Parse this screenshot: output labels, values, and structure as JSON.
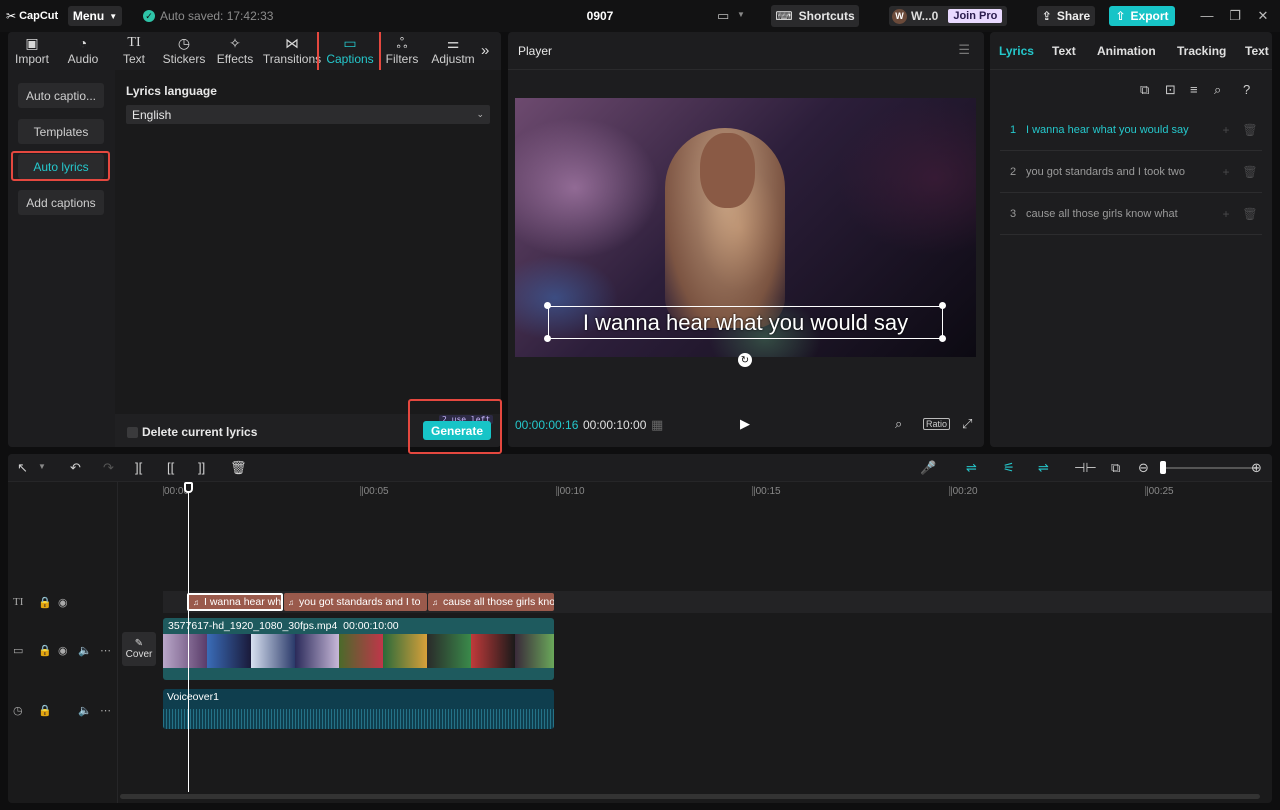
{
  "app": {
    "logo": "CapCut",
    "menu_label": "Menu",
    "autosave": "Auto saved: 17:42:33",
    "project_title": "0907",
    "shortcuts_label": "Shortcuts",
    "user_name": "W...0",
    "join_pro_label": "Join Pro",
    "share_label": "Share",
    "export_label": "Export",
    "accent": "#17c4c7"
  },
  "media_tabs": [
    {
      "label": "Import",
      "icon": "import-icon"
    },
    {
      "label": "Audio",
      "icon": "audio-icon"
    },
    {
      "label": "Text",
      "icon": "text-icon"
    },
    {
      "label": "Stickers",
      "icon": "stickers-icon"
    },
    {
      "label": "Effects",
      "icon": "effects-icon"
    },
    {
      "label": "Transitions",
      "icon": "transitions-icon"
    },
    {
      "label": "Captions",
      "icon": "captions-icon",
      "active": true
    },
    {
      "label": "Filters",
      "icon": "filters-icon"
    },
    {
      "label": "Adjustm",
      "icon": "adjustment-icon"
    }
  ],
  "captions_nav": [
    {
      "label": "Auto captio..."
    },
    {
      "label": "Templates"
    },
    {
      "label": "Auto lyrics",
      "active": true
    },
    {
      "label": "Add captions"
    }
  ],
  "lyrics_panel": {
    "language_label": "Lyrics language",
    "language_value": "English",
    "delete_label": "Delete current lyrics",
    "uses_left": "2 use left",
    "generate_label": "Generate"
  },
  "player": {
    "title": "Player",
    "caption_text": "I wanna hear what you would say",
    "current_time": "00:00:00:16",
    "total_time": "00:00:10:00",
    "ratio_label": "Ratio"
  },
  "right_tabs": [
    {
      "label": "Lyrics",
      "active": true
    },
    {
      "label": "Text"
    },
    {
      "label": "Animation"
    },
    {
      "label": "Tracking"
    },
    {
      "label": "Text"
    }
  ],
  "lyrics_list": [
    {
      "num": "1",
      "text": "I wanna hear what you would say",
      "active": true
    },
    {
      "num": "2",
      "text": "you got standards and I took two"
    },
    {
      "num": "3",
      "text": "cause all those girls know what"
    }
  ],
  "timeline": {
    "ticks": [
      "00:00",
      "|00:05",
      "|00:10",
      "|00:15",
      "|00:20",
      "|00:25"
    ],
    "cover_label": "Cover",
    "lyric_clips": [
      "I wanna hear wh",
      "you got standards and I to",
      "cause all those girls kno"
    ],
    "video_clip_name": "3577617-hd_1920_1080_30fps.mp4",
    "video_clip_duration": "00:00:10:00",
    "audio_clip_name": "Voiceover1"
  }
}
